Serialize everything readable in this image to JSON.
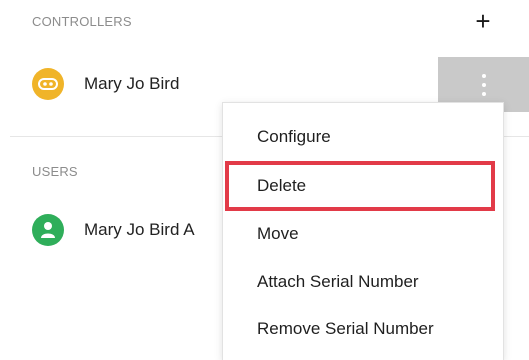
{
  "controllers": {
    "title": "CONTROLLERS",
    "add_label": "+",
    "items": [
      {
        "label": "Mary Jo Bird",
        "avatar_icon": "controller-icon",
        "avatar_color": "#f0b429"
      }
    ]
  },
  "users": {
    "title": "USERS",
    "items": [
      {
        "label": "Mary Jo Bird A",
        "avatar_icon": "person-icon",
        "avatar_color": "#2fae5a"
      }
    ]
  },
  "context_menu": {
    "items": [
      {
        "label": "Configure"
      },
      {
        "label": "Delete",
        "highlighted": true
      },
      {
        "label": "Move"
      },
      {
        "label": "Attach Serial Number"
      },
      {
        "label": "Remove Serial Number"
      }
    ]
  },
  "colors": {
    "highlight": "#e23a48",
    "kebab_bg": "#c9c9c9"
  }
}
